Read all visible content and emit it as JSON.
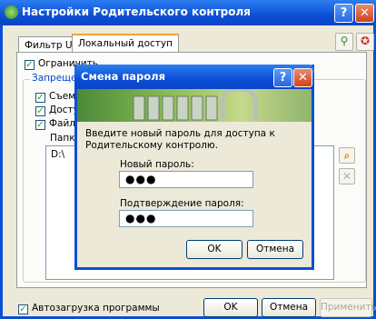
{
  "window": {
    "title": "Настройки Родительского контроля",
    "help_label": "?",
    "close_label": "✕"
  },
  "tabs": [
    {
      "label": "Фильтр URL"
    },
    {
      "label": "Локальный доступ"
    }
  ],
  "panel": {
    "restrict_label": "Ограничить...",
    "group_label": "Запрещено",
    "items": [
      {
        "label": "Съемные..."
      },
      {
        "label": "Доступ..."
      },
      {
        "label": "Файлы и..."
      }
    ],
    "folders_label": "Папки и...",
    "folders": [
      "D:\\"
    ]
  },
  "dialog": {
    "title": "Смена пароля",
    "help_label": "?",
    "close_label": "✕",
    "instruction": "Введите новый пароль для доступа к Родительскому контролю.",
    "new_password_label": "Новый пароль:",
    "new_password_value": "●●●",
    "confirm_label": "Подтверждение пароля:",
    "confirm_value": "●●●",
    "ok_label": "OK",
    "cancel_label": "Отмена"
  },
  "footer": {
    "autoload_label": "Автозагрузка программы",
    "ok_label": "OK",
    "cancel_label": "Отмена",
    "apply_label": "Применить"
  },
  "colors": {
    "titlebar": "#0a4fd6",
    "accent_tab": "#f2a23a",
    "check": "#21a121"
  }
}
